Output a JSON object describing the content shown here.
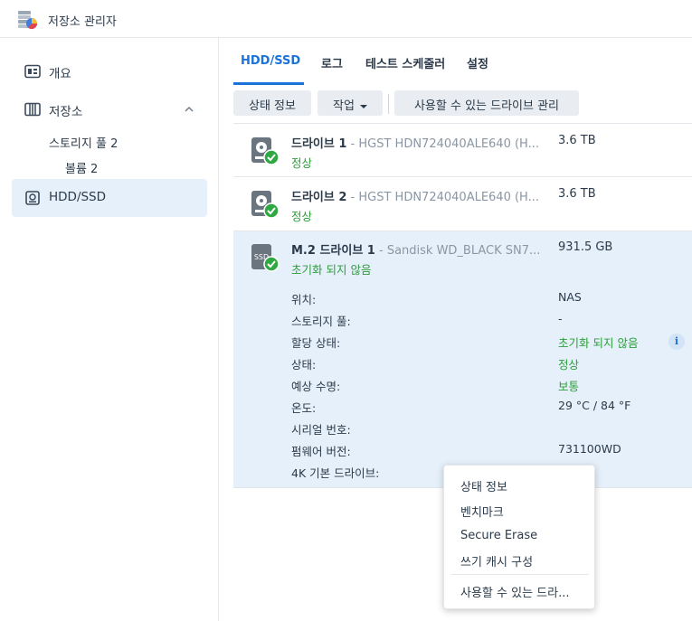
{
  "app": {
    "title": "저장소 관리자",
    "icon": "storage-manager-icon"
  },
  "sidebar": {
    "items": [
      {
        "label": "개요",
        "icon": "overview-icon"
      },
      {
        "label": "저장소",
        "icon": "storage-icon"
      },
      {
        "label": "HDD/SSD",
        "icon": "hdd-icon"
      }
    ],
    "sub": {
      "pool": "스토리지 풀 2",
      "volume": "볼륨 2"
    }
  },
  "tabs": [
    "HDD/SSD",
    "로그",
    "테스트 스케줄러",
    "설정"
  ],
  "toolbar": {
    "status_info": "상태 정보",
    "action": "작업",
    "manage_available": "사용할 수 있는 드라이브 관리"
  },
  "drives": [
    {
      "name": "드라이브 1",
      "model": " - HGST HDN724040ALE640 (H...",
      "capacity": "3.6 TB",
      "status": "정상"
    },
    {
      "name": "드라이브 2",
      "model": " - HGST HDN724040ALE640 (H...",
      "capacity": "3.6 TB",
      "status": "정상"
    },
    {
      "name": "M.2 드라이브 1",
      "model": " - Sandisk WD_BLACK SN7...",
      "capacity": "931.5 GB",
      "status": "초기화 되지 않음",
      "ssd_label": "SSD"
    }
  ],
  "details": [
    {
      "label": "위치:",
      "value": "NAS"
    },
    {
      "label": "스토리지 풀:",
      "value": "-"
    },
    {
      "label": "할당 상태:",
      "value": "초기화 되지 않음"
    },
    {
      "label": "상태:",
      "value": "정상"
    },
    {
      "label": "예상 수명:",
      "value": "보통"
    },
    {
      "label": "온도:",
      "value": "29 °C / 84 °F"
    },
    {
      "label": "시리얼 번호:",
      "value": ""
    },
    {
      "label": "펌웨어 버전:",
      "value": "731100WD"
    },
    {
      "label": "4K 기본 드라이브:",
      "value": ""
    }
  ],
  "info_glyph": "i",
  "context_menu": [
    "상태 정보",
    "벤치마크",
    "Secure Erase",
    "쓰기 캐시 구성",
    "사용할 수 있는 드라..."
  ],
  "colors": {
    "accent": "#1a73d9",
    "ok": "#2a9d3a",
    "selected_bg": "#e6f0fa"
  }
}
